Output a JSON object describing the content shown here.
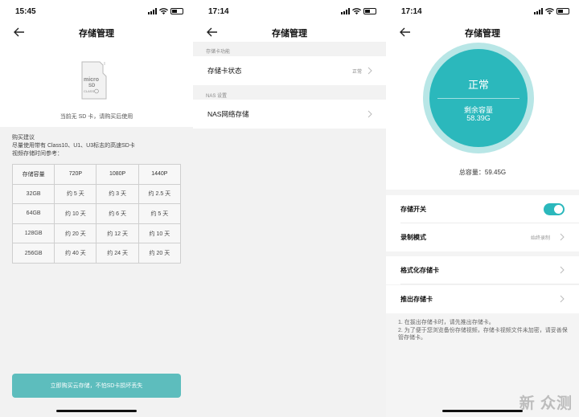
{
  "screen1": {
    "time": "15:45",
    "title": "存储管理",
    "sd_note": "当前无 SD 卡，请购买后使用",
    "advice": [
      "购买建议",
      "尽量使用带有 Class10、U1、U3标志的高速SD卡",
      "视频存储时间参考："
    ],
    "table_header": [
      "存储容量",
      "720P",
      "1080P",
      "1440P"
    ],
    "table_rows": [
      [
        "32GB",
        "约 5 天",
        "约 3 天",
        "约 2.5 天"
      ],
      [
        "64GB",
        "约 10 天",
        "约 6 天",
        "约 5 天"
      ],
      [
        "128GB",
        "约 20 天",
        "约 12 天",
        "约 10 天"
      ],
      [
        "256GB",
        "约 40 天",
        "约 24 天",
        "约 20 天"
      ]
    ],
    "buy_button": "立即购买云存储，不怕SD卡损坏丢失"
  },
  "screen2": {
    "time": "17:14",
    "title": "存储管理",
    "section1": "存储卡功能",
    "card_status_label": "存储卡状态",
    "card_status_value": "正常",
    "section2": "NAS 设置",
    "nas_label": "NAS网络存储"
  },
  "screen3": {
    "time": "17:14",
    "title": "存储管理",
    "status": "正常",
    "remain_label": "剩余容量",
    "remain_value": "58.39G",
    "total": "总容量：59.45G",
    "switch_label": "存储开关",
    "switch_on": true,
    "record_label": "录制模式",
    "record_value": "始终录制",
    "format_label": "格式化存储卡",
    "eject_label": "推出存储卡",
    "notes": [
      "1. 在拔出存储卡时，请先推出存储卡。",
      "2. 为了便于您浏览备份存储视频，存储卡视频文件未加密，请妥善保管存储卡。"
    ]
  },
  "watermark": "新 众测",
  "colors": {
    "accent": "#2bb8bc",
    "button": "#5dbdbd"
  },
  "icons": [
    "back-arrow-icon",
    "sd-card-icon",
    "chevron-right-icon",
    "signal-icon",
    "wifi-icon",
    "battery-icon"
  ]
}
